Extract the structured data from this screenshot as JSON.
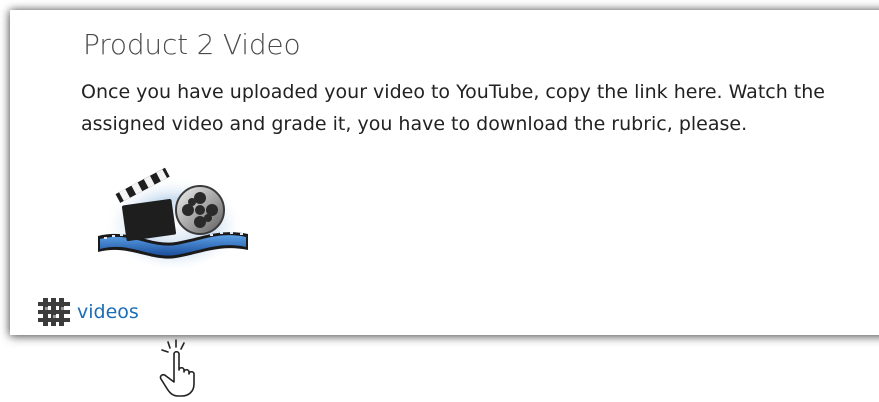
{
  "card": {
    "title": "Product 2 Video",
    "description": "Once you have uploaded your video to YouTube, copy the link here. Watch the assigned video and grade it, you have to download the rubric, please.",
    "image_icon": "film-clapper-reel-image",
    "link": {
      "icon": "folder-grid-icon",
      "label": "videos"
    }
  },
  "cursor": {
    "icon": "hand-pointer-icon"
  },
  "colors": {
    "link": "#1b6db8",
    "title": "#4a4a4a",
    "text": "#222222"
  }
}
